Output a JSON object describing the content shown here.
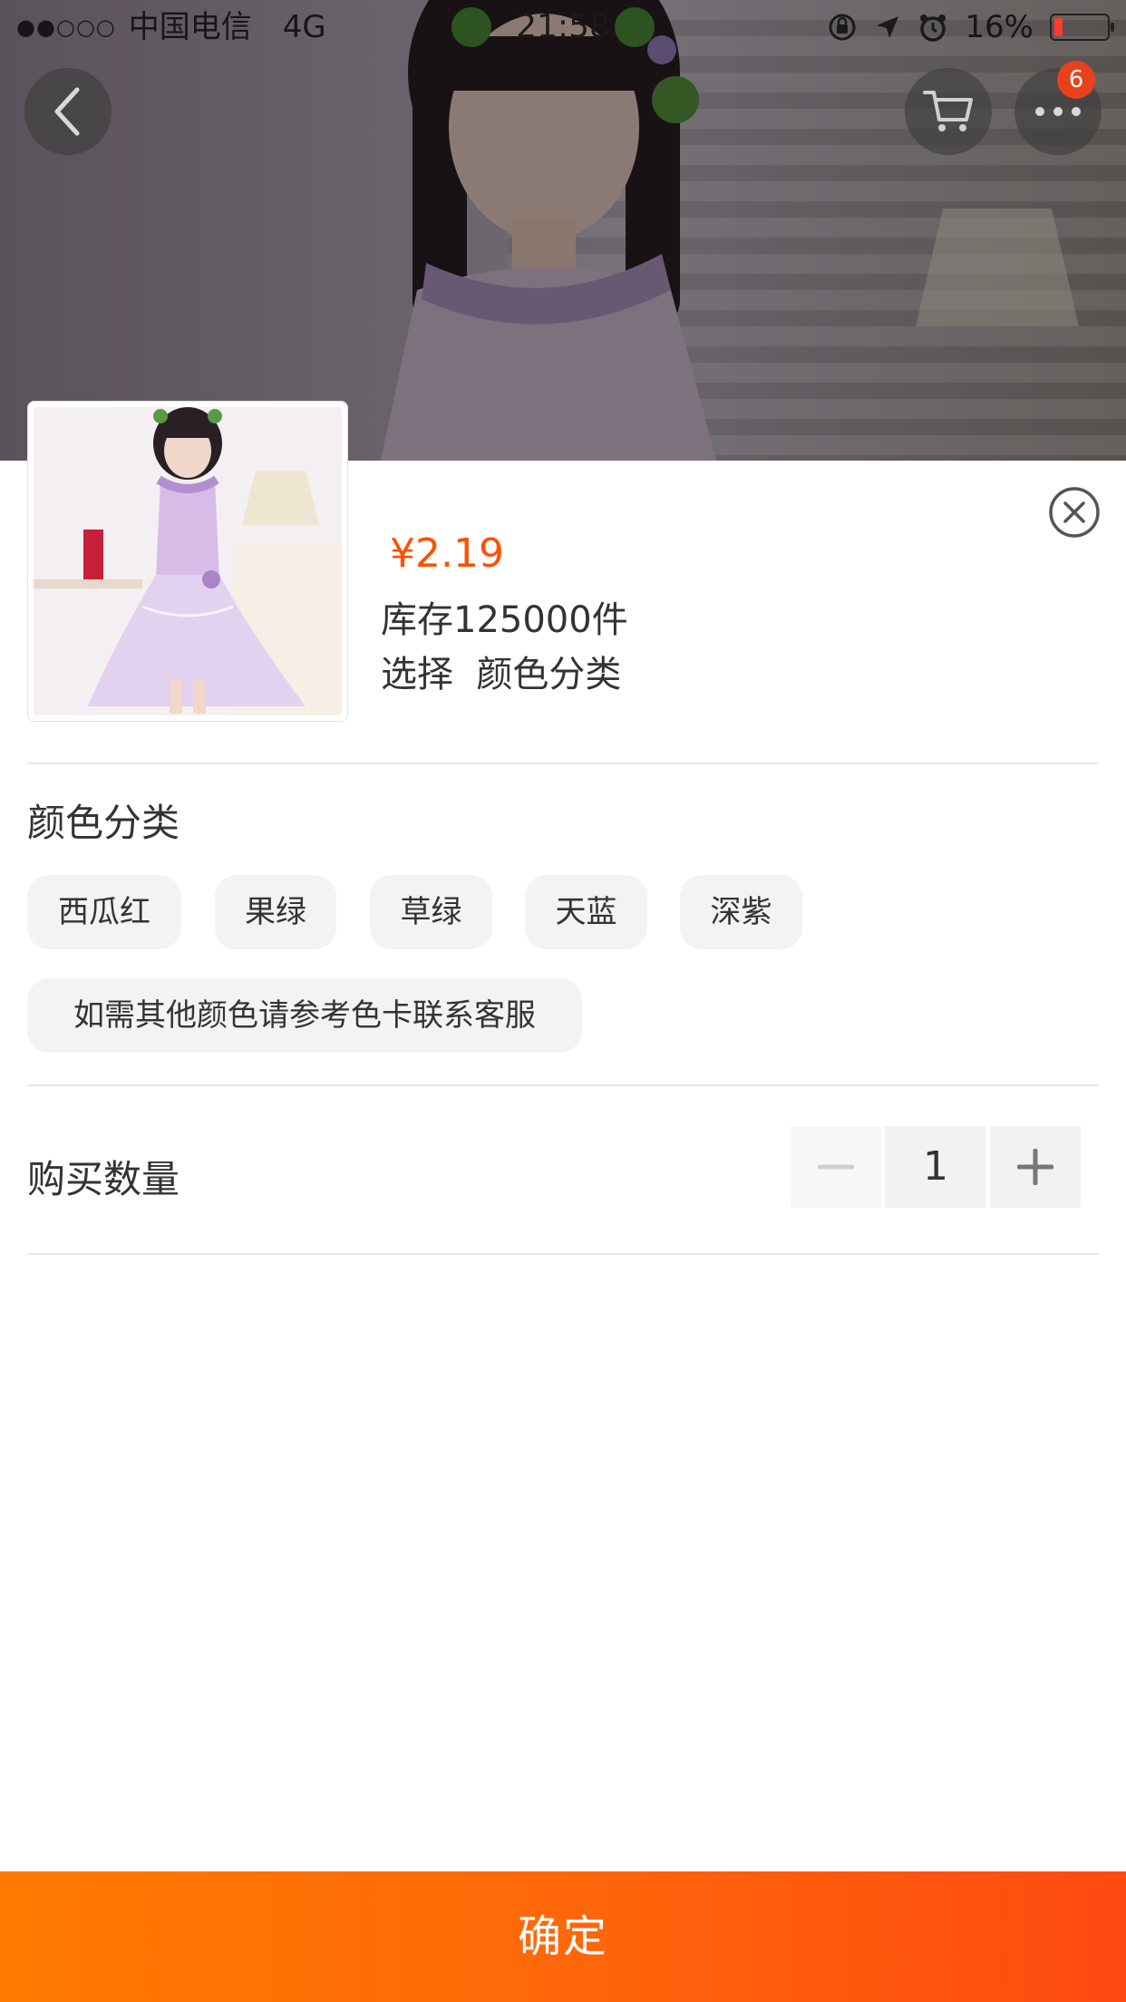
{
  "status_bar": {
    "signal": "●●○○○",
    "carrier": "中国电信",
    "network": "4G",
    "time": "21:58",
    "battery_percent": "16%",
    "battery_level": 0.16
  },
  "nav": {
    "cart_badge": "6"
  },
  "product": {
    "price": "¥2.19",
    "stock": "库存125000件",
    "select_hint": "选择  颜色分类"
  },
  "color_section": {
    "title": "颜色分类",
    "options": [
      "西瓜红",
      "果绿",
      "草绿",
      "天蓝",
      "深紫",
      "如需其他颜色请参考色卡联系客服"
    ]
  },
  "quantity": {
    "label": "购买数量",
    "value": "1"
  },
  "confirm_label": "确定",
  "colors": {
    "accent": "#ff5000",
    "confirm_gradient_start": "#ff7a00",
    "confirm_gradient_end": "#ff4a12",
    "chip_bg": "#f3f3f3",
    "badge": "#e8411b"
  }
}
